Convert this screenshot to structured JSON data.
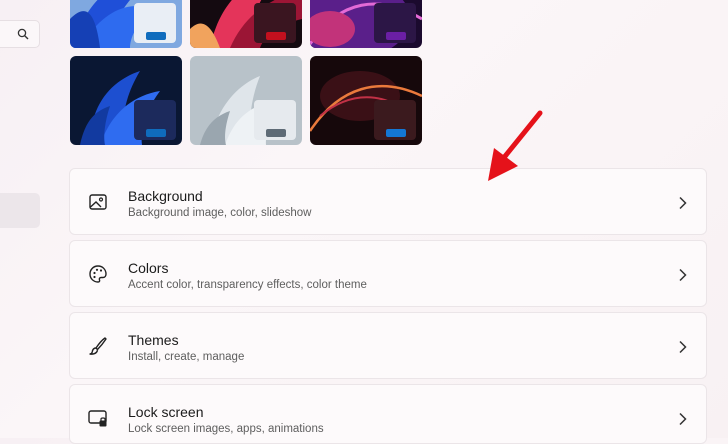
{
  "sidebar": {
    "search_icon": "search-icon"
  },
  "themes": [
    {
      "name": "bloom-blue-light",
      "accent": "#0f6cbd"
    },
    {
      "name": "glow-red",
      "accent": "#c3101e"
    },
    {
      "name": "sunrise-purple",
      "accent": "#6b1fa5"
    },
    {
      "name": "bloom-blue-dark",
      "accent": "#0f6cbd"
    },
    {
      "name": "flow-gray",
      "accent": "#5e6b76"
    },
    {
      "name": "captured-motion",
      "accent": "#1477d4"
    }
  ],
  "settings": [
    {
      "title": "Background",
      "subtitle": "Background image, color, slideshow",
      "icon": "picture-icon"
    },
    {
      "title": "Colors",
      "subtitle": "Accent color, transparency effects, color theme",
      "icon": "palette-icon"
    },
    {
      "title": "Themes",
      "subtitle": "Install, create, manage",
      "icon": "brush-icon"
    },
    {
      "title": "Lock screen",
      "subtitle": "Lock screen images, apps, animations",
      "icon": "lock-screen-icon"
    }
  ],
  "annotation": {
    "color": "#e5121a"
  }
}
